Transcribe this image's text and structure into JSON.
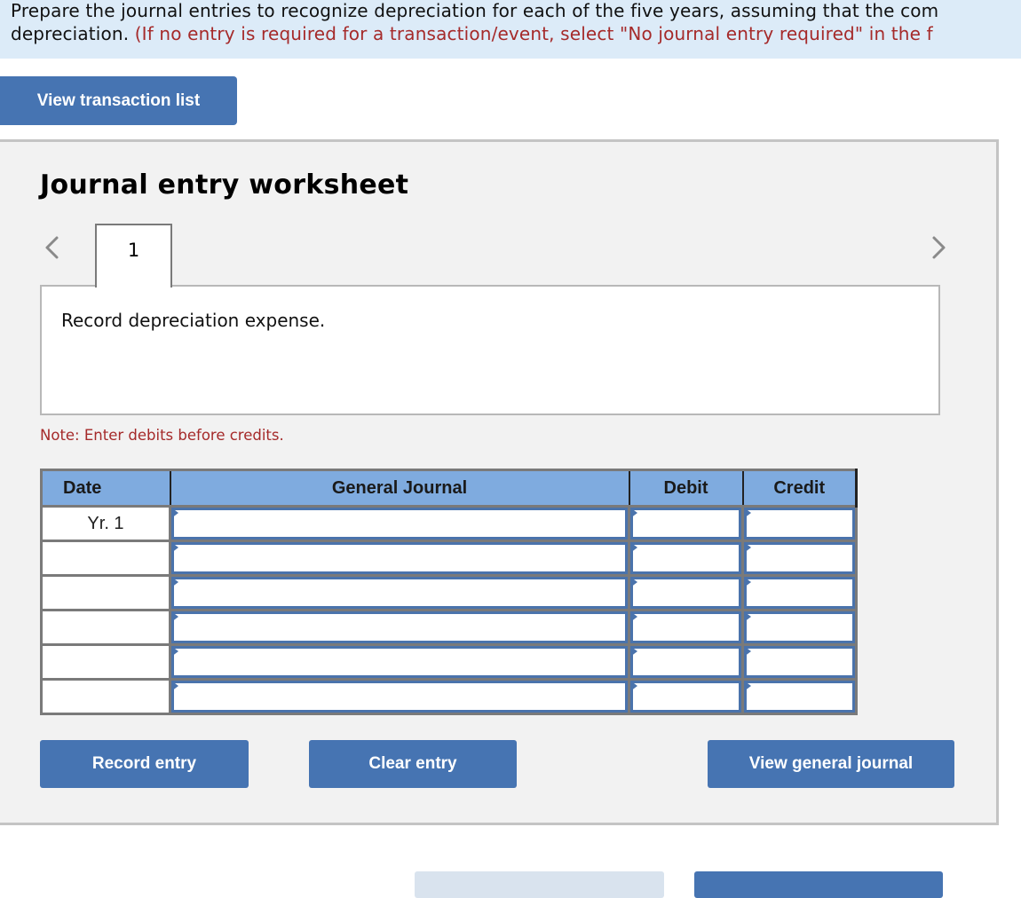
{
  "instructions": {
    "line1": "Prepare the journal entries to recognize depreciation for each of the five years, assuming that the com",
    "line2_black": "depreciation. ",
    "line2_red": "(If no entry is required for a transaction/event, select \"No journal entry required\" in the f"
  },
  "buttons": {
    "view_transaction_list": "View transaction list",
    "record_entry": "Record entry",
    "clear_entry": "Clear entry",
    "view_general_journal": "View general journal"
  },
  "worksheet": {
    "title": "Journal entry worksheet",
    "active_tab": "1",
    "description": "Record depreciation expense.",
    "note": "Note: Enter debits before credits."
  },
  "journal": {
    "headers": {
      "date": "Date",
      "general_journal": "General Journal",
      "debit": "Debit",
      "credit": "Credit"
    },
    "rows": [
      {
        "date": "Yr. 1",
        "account": "",
        "debit": "",
        "credit": ""
      },
      {
        "date": "",
        "account": "",
        "debit": "",
        "credit": ""
      },
      {
        "date": "",
        "account": "",
        "debit": "",
        "credit": ""
      },
      {
        "date": "",
        "account": "",
        "debit": "",
        "credit": ""
      },
      {
        "date": "",
        "account": "",
        "debit": "",
        "credit": ""
      },
      {
        "date": "",
        "account": "",
        "debit": "",
        "credit": ""
      }
    ]
  },
  "icons": {
    "prev": "chevron-left-icon",
    "next": "chevron-right-icon"
  },
  "colors": {
    "primary_button": "#4674b2",
    "header_fill": "#7fabdf",
    "instruction_bg": "#dcebf8",
    "note_red": "#a52a2a"
  }
}
